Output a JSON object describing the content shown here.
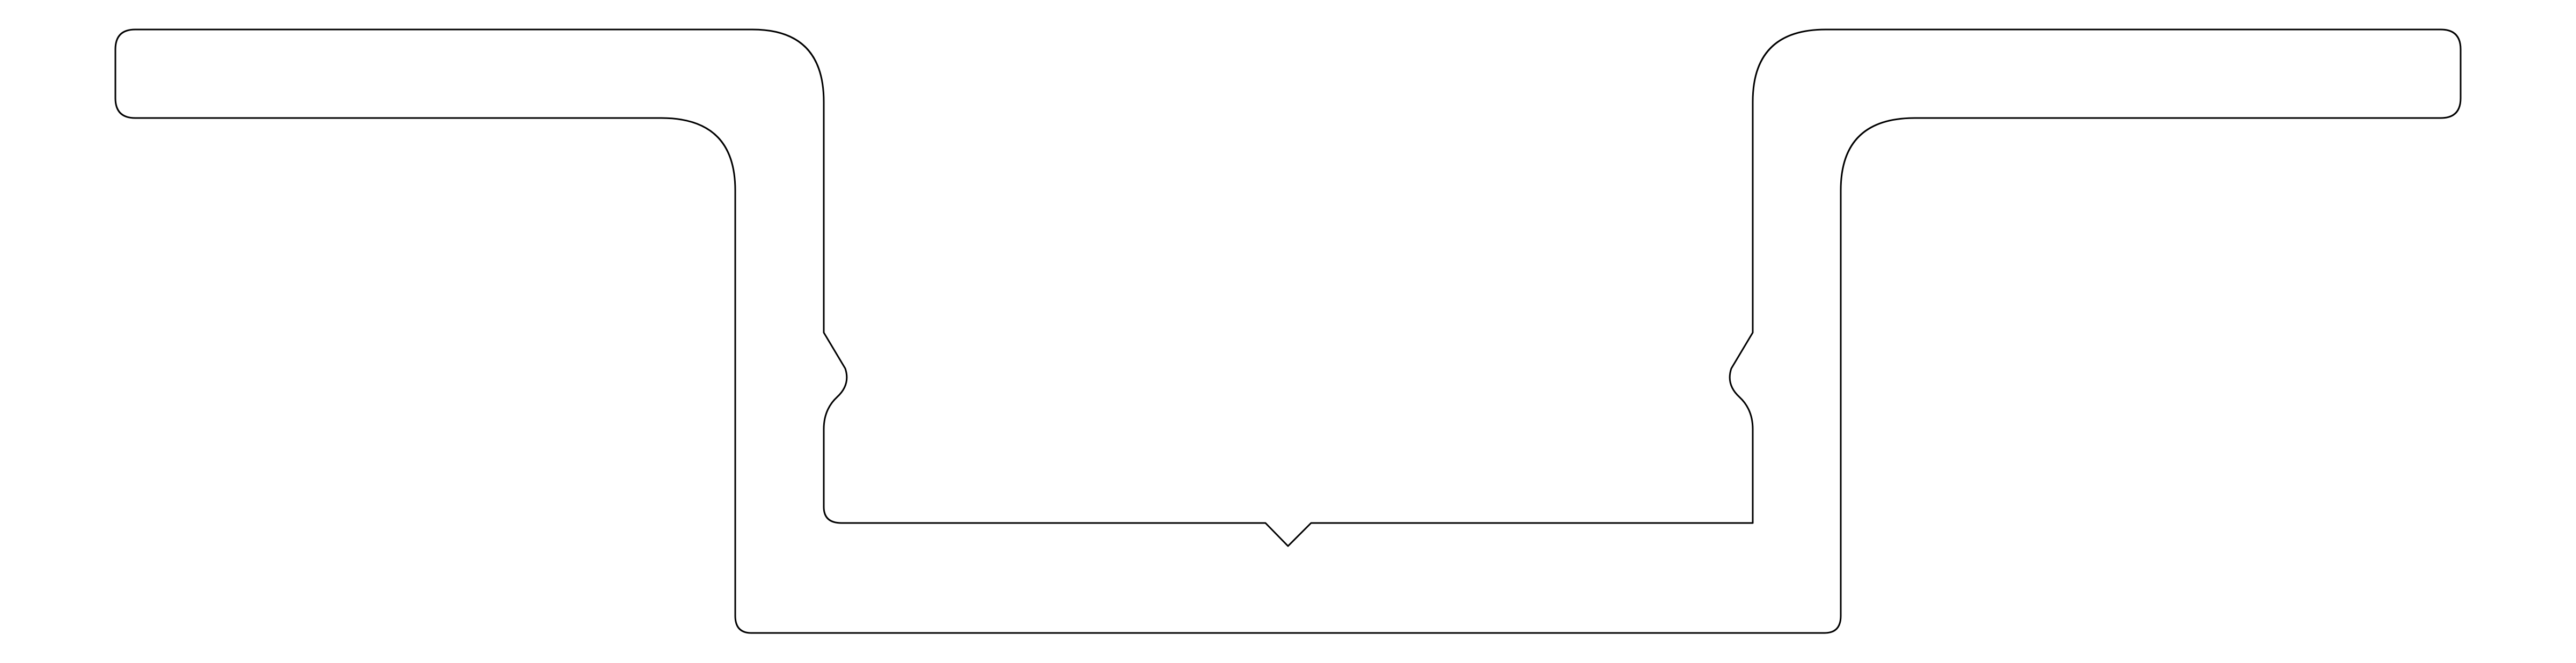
{
  "diagram": {
    "kind": "extrusion-profile-outline",
    "background_color": "#ffffff",
    "line_color": "#000000",
    "features": {
      "left_flange": "flange",
      "right_flange": "flange",
      "left_snap_bump": "snap-bump",
      "right_snap_bump": "snap-bump",
      "bottom_v_notch": "v-notch"
    }
  }
}
